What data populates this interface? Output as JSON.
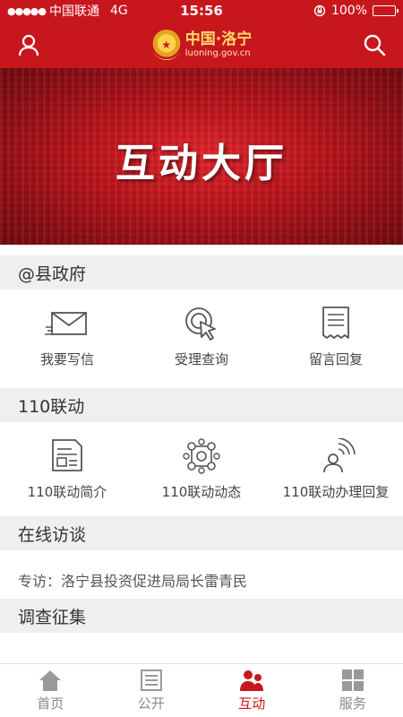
{
  "status_bar": {
    "signal": "●●●●●",
    "carrier": "中国联通",
    "network": "4G",
    "time": "15:56",
    "orientation_lock_icon": "orientation-lock-icon",
    "battery_text": "100%",
    "battery_level": 1.0
  },
  "header": {
    "logo_title": "中国·洛宁",
    "logo_url": "luoning.gov.cn",
    "emblem_glyph": "★",
    "user_icon": "user-icon",
    "search_icon": "search-icon"
  },
  "hero": {
    "title": "互动大厅"
  },
  "sections": {
    "county": {
      "title": "@县政府",
      "items": [
        {
          "label": "我要写信",
          "icon": "envelope-icon"
        },
        {
          "label": "受理查询",
          "icon": "query-cursor-icon"
        },
        {
          "label": "留言回复",
          "icon": "receipt-icon"
        }
      ]
    },
    "linkage": {
      "title": "110联动",
      "items": [
        {
          "label": "110联动简介",
          "icon": "document-icon"
        },
        {
          "label": "110联动动态",
          "icon": "network-nodes-icon"
        },
        {
          "label": "110联动办理回复",
          "icon": "agent-signal-icon"
        }
      ]
    },
    "online_interview": {
      "title": "在线访谈",
      "latest": "专访：洛宁县投资促进局局长雷青民"
    },
    "survey": {
      "title": "调查征集"
    }
  },
  "tabs": [
    {
      "label": "首页",
      "icon": "home-icon",
      "active": false
    },
    {
      "label": "公开",
      "icon": "list-icon",
      "active": false
    },
    {
      "label": "互动",
      "icon": "people-icon",
      "active": true
    },
    {
      "label": "服务",
      "icon": "grid-icon",
      "active": false
    }
  ],
  "colors": {
    "brand_red": "#c8161d",
    "section_bg": "#efeff1",
    "logo_gold": "#ffd86a"
  }
}
